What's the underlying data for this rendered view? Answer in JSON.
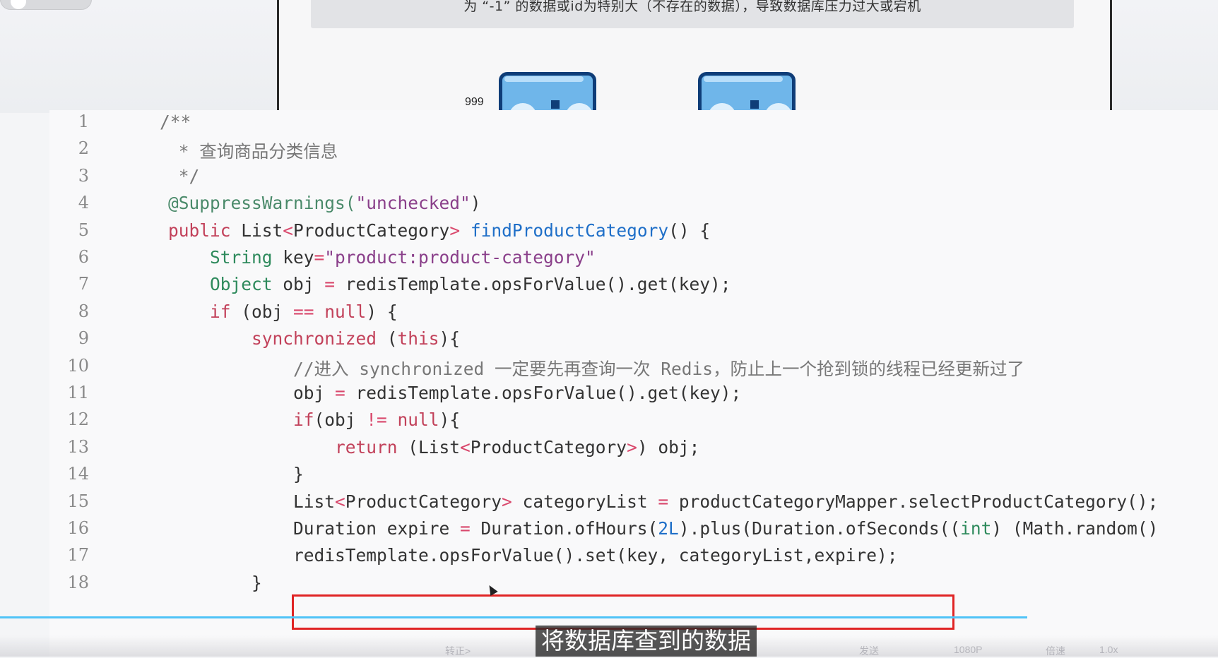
{
  "slide": {
    "caption": "为 “-1” 的数据或id为特别大（不存在的数据），导致数据库压力过大或宕机",
    "diagram_label": "999"
  },
  "code": {
    "line_numbers": [
      "1",
      "2",
      "3",
      "4",
      "5",
      "6",
      "7",
      "8",
      "9",
      "10",
      "11",
      "12",
      "13",
      "14",
      "15",
      "16",
      "17",
      "18"
    ],
    "lines": [
      [
        {
          "t": "/**",
          "c": "comment"
        }
      ],
      [
        {
          "t": " * 查询商品分类信息",
          "c": "comment"
        }
      ],
      [
        {
          "t": " */",
          "c": "comment"
        }
      ],
      [
        {
          "t": "@SuppressWarnings(",
          "c": "anno"
        },
        {
          "t": "\"unchecked\"",
          "c": "str"
        },
        {
          "t": ")",
          "c": "plain"
        }
      ],
      [
        {
          "t": "public ",
          "c": "kw"
        },
        {
          "t": "List",
          "c": "plain"
        },
        {
          "t": "<",
          "c": "op"
        },
        {
          "t": "ProductCategory",
          "c": "plain"
        },
        {
          "t": "> ",
          "c": "op"
        },
        {
          "t": "findProductCategory",
          "c": "method"
        },
        {
          "t": "() {",
          "c": "plain"
        }
      ],
      [
        {
          "t": "    String ",
          "c": "type"
        },
        {
          "t": "key",
          "c": "plain"
        },
        {
          "t": "=",
          "c": "op"
        },
        {
          "t": "\"product:product-category\"",
          "c": "str"
        }
      ],
      [
        {
          "t": "    Object ",
          "c": "type"
        },
        {
          "t": "obj ",
          "c": "plain"
        },
        {
          "t": "= ",
          "c": "op"
        },
        {
          "t": "redisTemplate.opsForValue().get(key);",
          "c": "plain"
        }
      ],
      [
        {
          "t": "    if ",
          "c": "kw"
        },
        {
          "t": "(obj ",
          "c": "plain"
        },
        {
          "t": "== ",
          "c": "op"
        },
        {
          "t": "null",
          "c": "kw"
        },
        {
          "t": ") {",
          "c": "plain"
        }
      ],
      [
        {
          "t": "        synchronized ",
          "c": "kw"
        },
        {
          "t": "(",
          "c": "plain"
        },
        {
          "t": "this",
          "c": "kw"
        },
        {
          "t": "){",
          "c": "plain"
        }
      ],
      [
        {
          "t": "            //进入 synchronized 一定要先再查询一次 Redis，防止上一个抢到锁的线程已经更新过了",
          "c": "comment"
        }
      ],
      [
        {
          "t": "            obj ",
          "c": "plain"
        },
        {
          "t": "= ",
          "c": "op"
        },
        {
          "t": "redisTemplate.opsForValue().get(key);",
          "c": "plain"
        }
      ],
      [
        {
          "t": "            if",
          "c": "kw"
        },
        {
          "t": "(obj ",
          "c": "plain"
        },
        {
          "t": "!= ",
          "c": "op"
        },
        {
          "t": "null",
          "c": "kw"
        },
        {
          "t": "){",
          "c": "plain"
        }
      ],
      [
        {
          "t": "                return ",
          "c": "kw"
        },
        {
          "t": "(List",
          "c": "plain"
        },
        {
          "t": "<",
          "c": "op"
        },
        {
          "t": "ProductCategory",
          "c": "plain"
        },
        {
          "t": ">",
          "c": "op"
        },
        {
          "t": ") obj;",
          "c": "plain"
        }
      ],
      [
        {
          "t": "            }",
          "c": "plain"
        }
      ],
      [
        {
          "t": "            List",
          "c": "plain"
        },
        {
          "t": "<",
          "c": "op"
        },
        {
          "t": "ProductCategory",
          "c": "plain"
        },
        {
          "t": "> ",
          "c": "op"
        },
        {
          "t": "categoryList ",
          "c": "plain"
        },
        {
          "t": "= ",
          "c": "op"
        },
        {
          "t": "productCategoryMapper.selectProductCategory();",
          "c": "plain"
        }
      ],
      [
        {
          "t": "            Duration expire ",
          "c": "plain"
        },
        {
          "t": "= ",
          "c": "op"
        },
        {
          "t": "Duration.ofHours(",
          "c": "plain"
        },
        {
          "t": "2L",
          "c": "num"
        },
        {
          "t": ").plus(Duration.ofSeconds((",
          "c": "plain"
        },
        {
          "t": "int",
          "c": "type"
        },
        {
          "t": ") (Math.random()",
          "c": "plain"
        }
      ],
      [
        {
          "t": "            redisTemplate.opsForValue().set(key, categoryList,expire);",
          "c": "plain"
        }
      ],
      [
        {
          "t": "        }",
          "c": "plain"
        }
      ]
    ]
  },
  "player": {
    "subtitle": "将数据库查到的数据",
    "controls": [
      "转正>",
      "发送",
      "1080P",
      "倍速",
      "1.0x"
    ]
  },
  "colors": {
    "highlight": "#e02424",
    "progress": "#4fc3f7",
    "keyword": "#c2415a",
    "type": "#2e8a5c",
    "string": "#8a3f8a",
    "method": "#1f6fc8"
  }
}
